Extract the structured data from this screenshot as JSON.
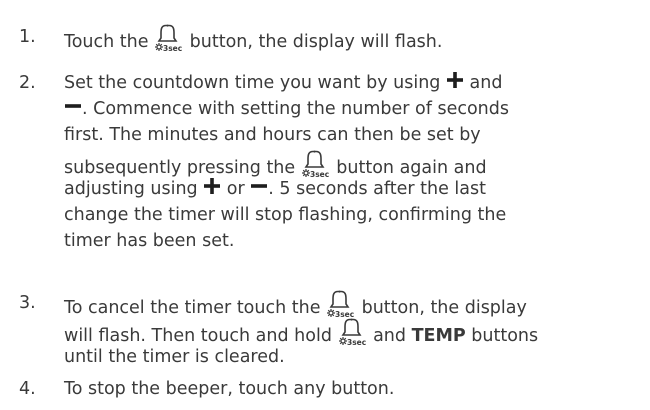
{
  "icons": {
    "bell": "timer-bell-3sec-icon",
    "plus": "plus-icon",
    "minus": "minus-icon",
    "bell_label": "3sec"
  },
  "steps": [
    {
      "number": "1.",
      "s1": "Touch the ",
      "s2": " button, the display will flash."
    },
    {
      "number": "2.",
      "l1a": "Set the countdown time you want by using ",
      "l1b": " and",
      "l2": ". Commence with setting the number of seconds",
      "l3": "first. The minutes and hours can then be set by",
      "l4a": "subsequently pressing the ",
      "l4b": " button again and",
      "l5a": "adjusting using ",
      "l5b": " or ",
      "l5c": ". 5 seconds after the last",
      "l6": "change the timer will stop flashing, confirming the",
      "l7": "timer has been set."
    },
    {
      "number": "3.",
      "l1a": "To cancel the timer touch the ",
      "l1b": " button, the display",
      "l2a": "will flash. Then touch and hold ",
      "l2b": " and ",
      "l2bold": "TEMP",
      "l2c": " buttons",
      "l3": "until the timer is cleared."
    },
    {
      "number": "4.",
      "text": "To stop the beeper, touch any button."
    }
  ]
}
